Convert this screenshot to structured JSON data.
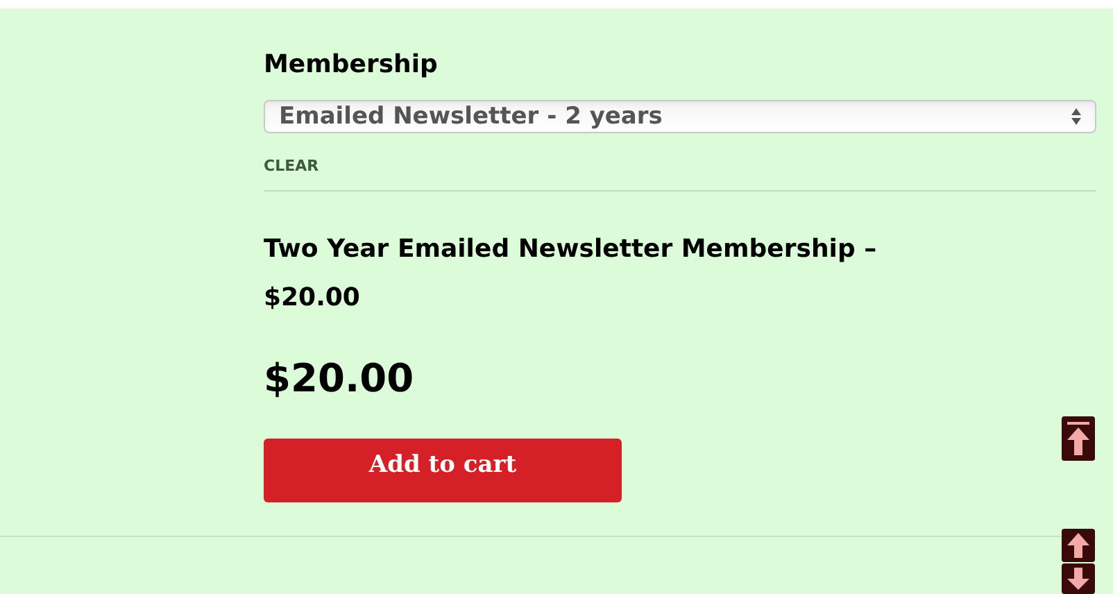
{
  "variation": {
    "label": "Membership",
    "select_value": "Emailed Newsletter - 2 years",
    "clear_link": "CLEAR"
  },
  "product": {
    "variation_title": "Two Year Emailed Newsletter Membership – $20.00",
    "price": "$20.00",
    "add_to_cart": "Add to cart"
  }
}
